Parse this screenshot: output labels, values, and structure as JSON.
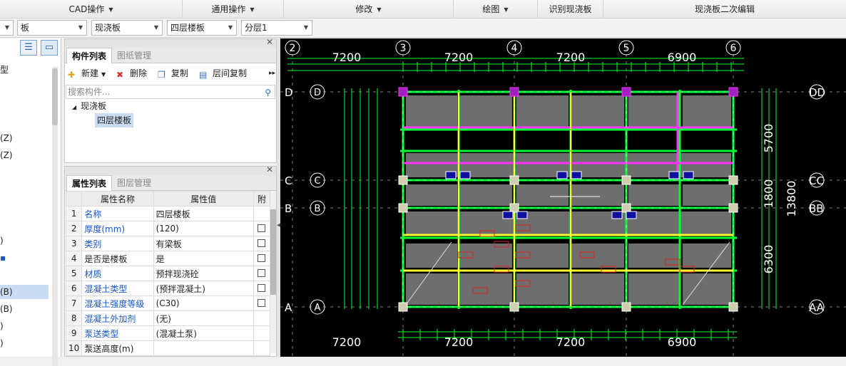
{
  "ribbon": {
    "groups": [
      {
        "label": "CAD操作",
        "has_menu": true
      },
      {
        "label": "通用操作",
        "has_menu": true
      },
      {
        "label": "修改",
        "has_menu": true
      },
      {
        "label": "绘图",
        "has_menu": true
      },
      {
        "label": "识别现浇板",
        "has_menu": false
      },
      {
        "label": "现浇板二次编辑",
        "has_menu": false
      }
    ]
  },
  "toolbar_combos": {
    "c1": "板",
    "c2": "现浇板",
    "c3": "四层楼板",
    "c4": "分层1"
  },
  "left_panel": {
    "items": [
      "型",
      "(Z)",
      "(Z)",
      ")",
      "(B)",
      "(B)"
    ]
  },
  "component_panel": {
    "tabs": [
      "构件列表",
      "图纸管理"
    ],
    "buttons": {
      "new": "新建",
      "delete": "删除",
      "copy": "复制",
      "floor_copy": "层间复制"
    },
    "search_placeholder": "搜索构件...",
    "tree": {
      "parent": "现浇板",
      "child": "四层楼板"
    }
  },
  "property_panel": {
    "tabs": [
      "属性列表",
      "图层管理"
    ],
    "headers": {
      "name": "属性名称",
      "value": "属性值",
      "extra": "附"
    },
    "rows": [
      {
        "no": "1",
        "name": "名称",
        "value": "四层楼板",
        "blue": true,
        "check": false
      },
      {
        "no": "2",
        "name": "厚度(mm)",
        "value": "(120)",
        "blue": true,
        "check": true
      },
      {
        "no": "3",
        "name": "类别",
        "value": "有梁板",
        "blue": true,
        "check": true
      },
      {
        "no": "4",
        "name": "是否是楼板",
        "value": "是",
        "blue": false,
        "check": true
      },
      {
        "no": "5",
        "name": "材质",
        "value": "预拌现浇砼",
        "blue": true,
        "check": true
      },
      {
        "no": "6",
        "name": "混凝土类型",
        "value": "(预拌混凝土)",
        "blue": true,
        "check": true
      },
      {
        "no": "7",
        "name": "混凝土强度等级",
        "value": "(C30)",
        "blue": true,
        "check": true
      },
      {
        "no": "8",
        "name": "混凝土外加剂",
        "value": "(无)",
        "blue": true,
        "check": false
      },
      {
        "no": "9",
        "name": "泵送类型",
        "value": "(混凝土泵)",
        "blue": true,
        "check": false
      },
      {
        "no": "10",
        "name": "泵送高度(m)",
        "value": "",
        "blue": false,
        "check": false
      }
    ]
  },
  "cad": {
    "axis_numbers_top": [
      "2",
      "3",
      "4",
      "5",
      "6"
    ],
    "axis_letters_left": [
      "D",
      "C",
      "B",
      "A"
    ],
    "axis_letters_right": [
      "DD",
      "CC",
      "BB",
      "AA"
    ],
    "top_dims": [
      "7200",
      "7200",
      "7200",
      "6900"
    ],
    "bottom_dims": [
      "7200",
      "7200",
      "7200",
      "6900"
    ],
    "right_dims": [
      "5700",
      "1800",
      "6300",
      "13800"
    ],
    "colors": {
      "background": "#000000",
      "grid": "#00ff33",
      "slab": "#6e6e6e",
      "magenta_beam": "#ff33ff",
      "yellow_beam": "#ffff33"
    }
  }
}
